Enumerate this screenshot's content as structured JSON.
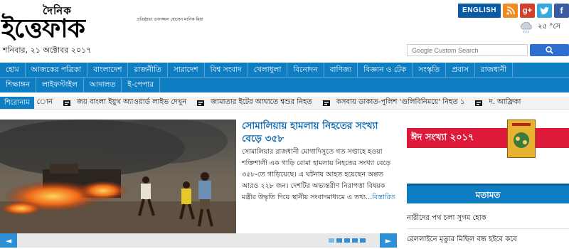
{
  "header": {
    "logo_small": "দৈনিক",
    "logo_big": "ইত্তেফাক",
    "logo_tagline": "প্রতিষ্ঠাতা তফাজ্জল হোসেন মানিক মিয়া",
    "date": "শনিবার, ২১ অক্টোবর ২০১৭",
    "english_button": "ENGLISH",
    "temperature": "২৫ °সে",
    "search_placeholder": "Google Custom Search"
  },
  "nav": {
    "row1": [
      "হোম",
      "আজকের পত্রিকা",
      "বাংলাদেশ",
      "রাজনীতি",
      "সারাদেশ",
      "বিশ্ব সংবাদ",
      "খেলাধুলা",
      "বিনোদন",
      "বাণিজ্য",
      "বিজ্ঞান ও টেক",
      "সংস্কৃতি",
      "প্রবাস",
      "রাজধানী"
    ],
    "row2": [
      "শিক্ষাঙ্গন",
      "লাইফস্টাইল",
      "আদালত",
      "ই-পেপার"
    ]
  },
  "ticker": {
    "label": "শিরোনাম",
    "lead": "োন",
    "items": [
      "জয় বাংলা ইয়ুথ অ্যাওয়ার্ড লাইভ দেখুন",
      "জামাতার ইটের আঘাতে শ্বশুর নিহত",
      "কসবায় ডাকাত-পুলিশ 'গুলিবিনিময়ে' নিহত ১",
      "দ. আফ্রিকা"
    ]
  },
  "lead_story": {
    "headline": "সোমালিয়ায় হামলায় নিহতের সংখ্যা বেড়ে ৩৫৮",
    "body": "সোমালিয়ার রাজধানী মোগাদিসুতে গত সপ্তাহে হওয়া শক্তিশালী এক গাড়ি বোমা হামলায় নিহতের সংখ্যা বেড়ে ৩৫৮-তে গাড়িয়েছে। এ ঘটনায় আহত হয়েছেন অন্তত আরও ২২৮ জন। দেশটির অভ্যন্তরীণ নিরাপত্তা বিষয়ক মন্ত্রীর উদ্ধৃতি দিয়ে স্থানীয় সংবাদমাধ্যমে এ তথ্য...",
    "read_more": "বিস্তারিত"
  },
  "sidebar": {
    "eid_banner": "ঈদ সংখ্যা ২০১৭",
    "opinion_title": "মতামত",
    "opinion_items": [
      "নারীদের পথ চলা সুগম হোক",
      "রেললাইনে মৃত্যুর মিছিল বন্ধ হইবে কবে"
    ]
  },
  "colors": {
    "brand_blue": "#0f7dc2",
    "eid_red": "#dd1a3a"
  }
}
